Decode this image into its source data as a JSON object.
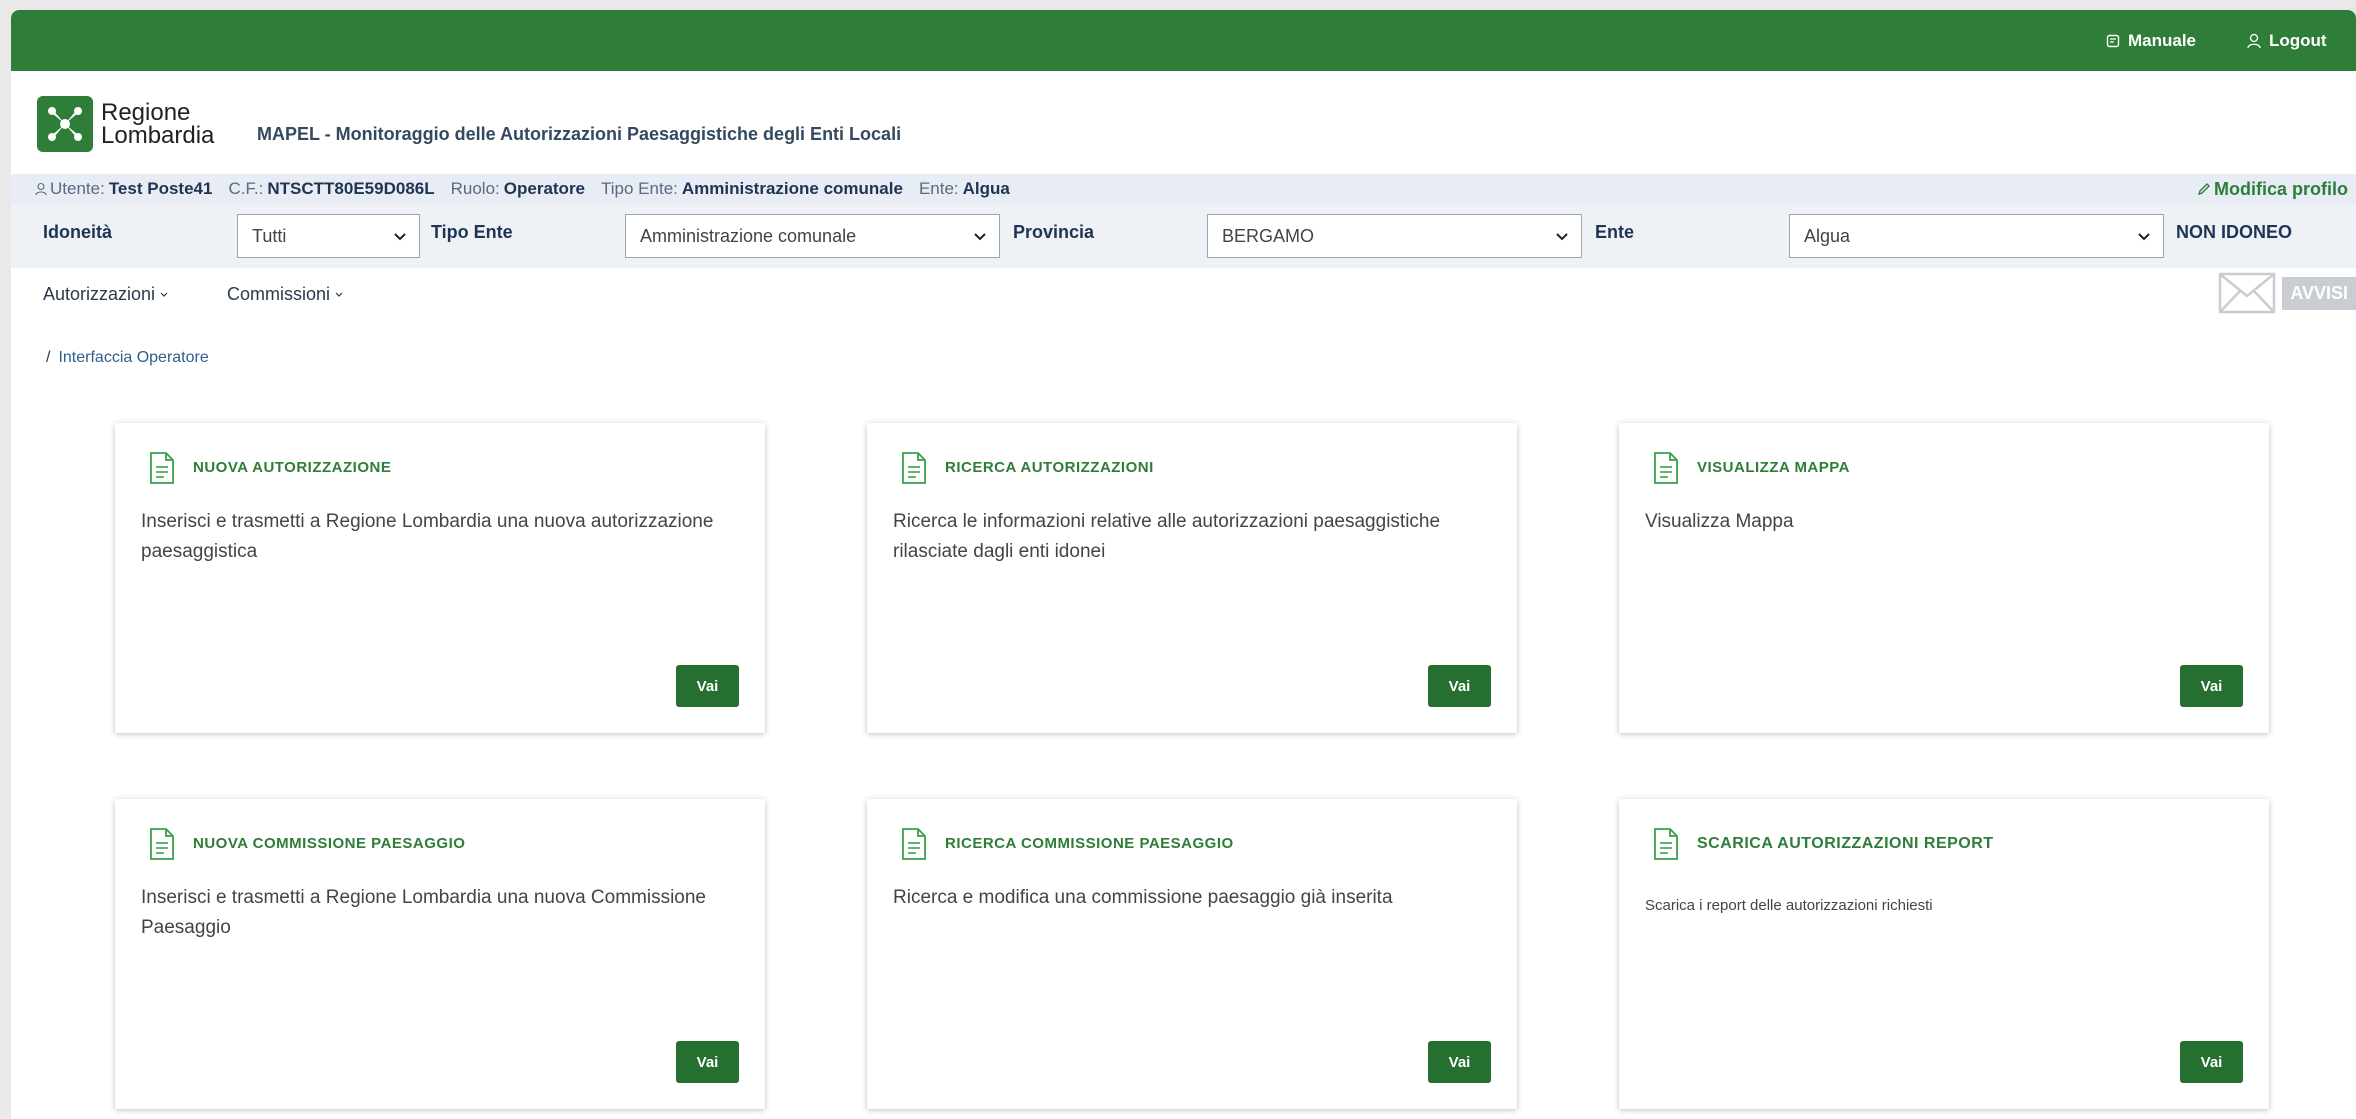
{
  "topbar": {
    "manual_label": "Manuale",
    "logout_label": "Logout"
  },
  "brand": {
    "logo_line1": "Regione",
    "logo_line2": "Lombardia",
    "app_title": "MAPEL - Monitoraggio delle Autorizzazioni Paesaggistiche degli Enti Locali"
  },
  "user": {
    "utente_label": "Utente:",
    "utente_value": "Test Poste41",
    "cf_label": "C.F.:",
    "cf_value": "NTSCTT80E59D086L",
    "ruolo_label": "Ruolo:",
    "ruolo_value": "Operatore",
    "tipo_ente_label": "Tipo Ente:",
    "tipo_ente_value": "Amministrazione comunale",
    "ente_label": "Ente:",
    "ente_value": "Algua",
    "edit_profile": "Modifica profilo"
  },
  "filters": {
    "idoneita_label": "Idoneità",
    "idoneita_value": "Tutti",
    "tipo_ente_label": "Tipo Ente",
    "tipo_ente_value": "Amministrazione comunale",
    "provincia_label": "Provincia",
    "provincia_value": "BERGAMO",
    "ente_label": "Ente",
    "ente_value": "Algua",
    "status": "NON IDONEO"
  },
  "menu": {
    "autorizzazioni": "Autorizzazioni",
    "commissioni": "Commissioni",
    "avvisi": "AVVISI"
  },
  "breadcrumb": {
    "separator": "/",
    "current": "Interfaccia Operatore"
  },
  "cards": [
    {
      "title": "NUOVA AUTORIZZAZIONE",
      "desc": "Inserisci e trasmetti a Regione Lombardia una nuova autorizzazione paesaggistica",
      "button": "Vai"
    },
    {
      "title": "RICERCA AUTORIZZAZIONI",
      "desc": "Ricerca le informazioni relative alle autorizzazioni paesaggistiche rilasciate dagli enti idonei",
      "button": "Vai"
    },
    {
      "title": "VISUALIZZA MAPPA",
      "desc": "Visualizza Mappa",
      "button": "Vai"
    },
    {
      "title": "NUOVA COMMISSIONE PAESAGGIO",
      "desc": "Inserisci e trasmetti a Regione Lombardia una nuova Commissione Paesaggio",
      "button": "Vai"
    },
    {
      "title": "RICERCA COMMISSIONE PAESAGGIO",
      "desc": "Ricerca e modifica una commissione paesaggio già inserita",
      "button": "Vai"
    },
    {
      "title": "SCARICA AUTORIZZAZIONI REPORT",
      "desc": "Scarica i report delle autorizzazioni richiesti",
      "button": "Vai"
    }
  ],
  "colors": {
    "brand_green": "#2e7d38",
    "button_green": "#256f30",
    "userbar_bg": "#e8edf5"
  }
}
